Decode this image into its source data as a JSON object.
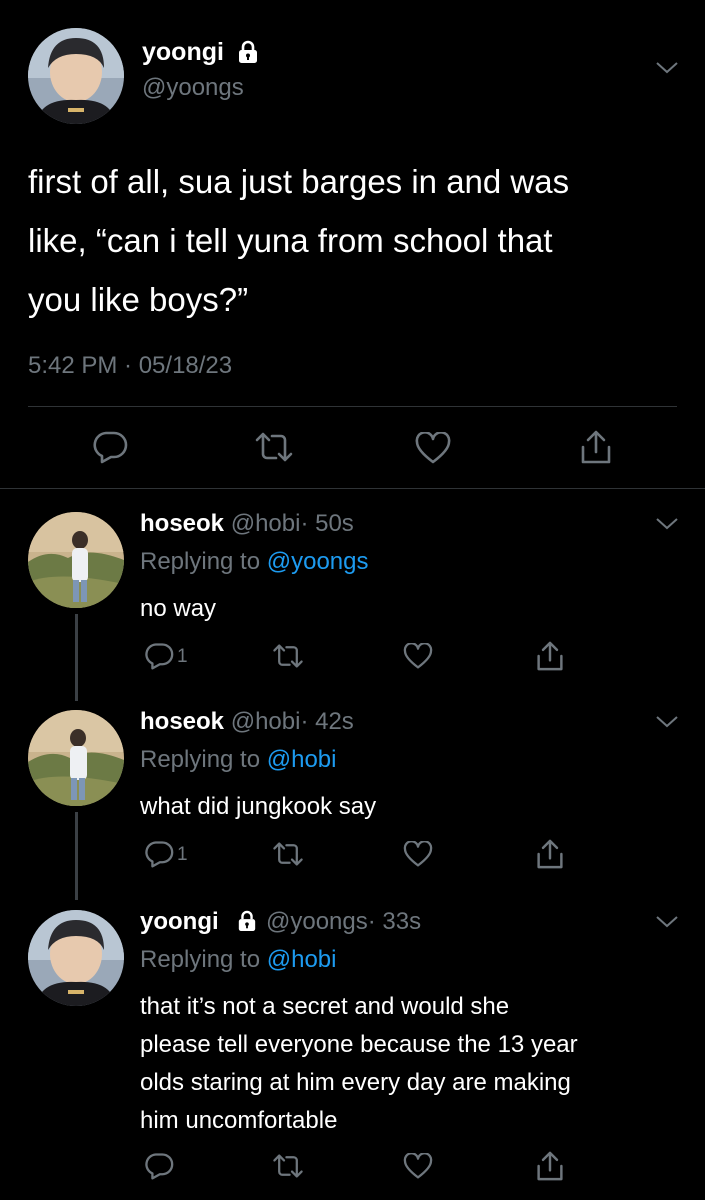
{
  "main_tweet": {
    "display_name": "yoongi",
    "handle": "@yoongs",
    "text_lines": [
      "first of all, sua just barges in and was",
      "like, “can i tell yuna from school that",
      "you like boys?”"
    ],
    "timestamp": "5:42 PM · 05/18/23",
    "icons": [
      "reply-icon",
      "retweet-icon",
      "like-icon",
      "share-icon"
    ]
  },
  "replies": [
    {
      "display_name": "hoseok",
      "handle": "@hobi",
      "time": "· 50s",
      "replying_prefix": "Replying to ",
      "replying_to": "@yoongs",
      "text_lines": [
        "no way"
      ],
      "reply_count": "1"
    },
    {
      "display_name": "hoseok",
      "handle": "@hobi",
      "time": "· 42s",
      "replying_prefix": "Replying to ",
      "replying_to": "@hobi",
      "text_lines": [
        "what did jungkook say"
      ],
      "reply_count": "1"
    },
    {
      "display_name": "yoongi",
      "handle": "@yoongs",
      "time": "· 33s",
      "replying_prefix": "Replying to ",
      "replying_to": "@hobi",
      "text_lines": [
        "that it’s not a secret and would she",
        "please tell everyone because the 13 year",
        "olds staring at him every day are making",
        "him uncomfortable"
      ],
      "reply_count": ""
    }
  ],
  "colors": {
    "background": "#000000",
    "text": "#ffffff",
    "muted": "#6e767d",
    "link": "#1d9bf0"
  }
}
